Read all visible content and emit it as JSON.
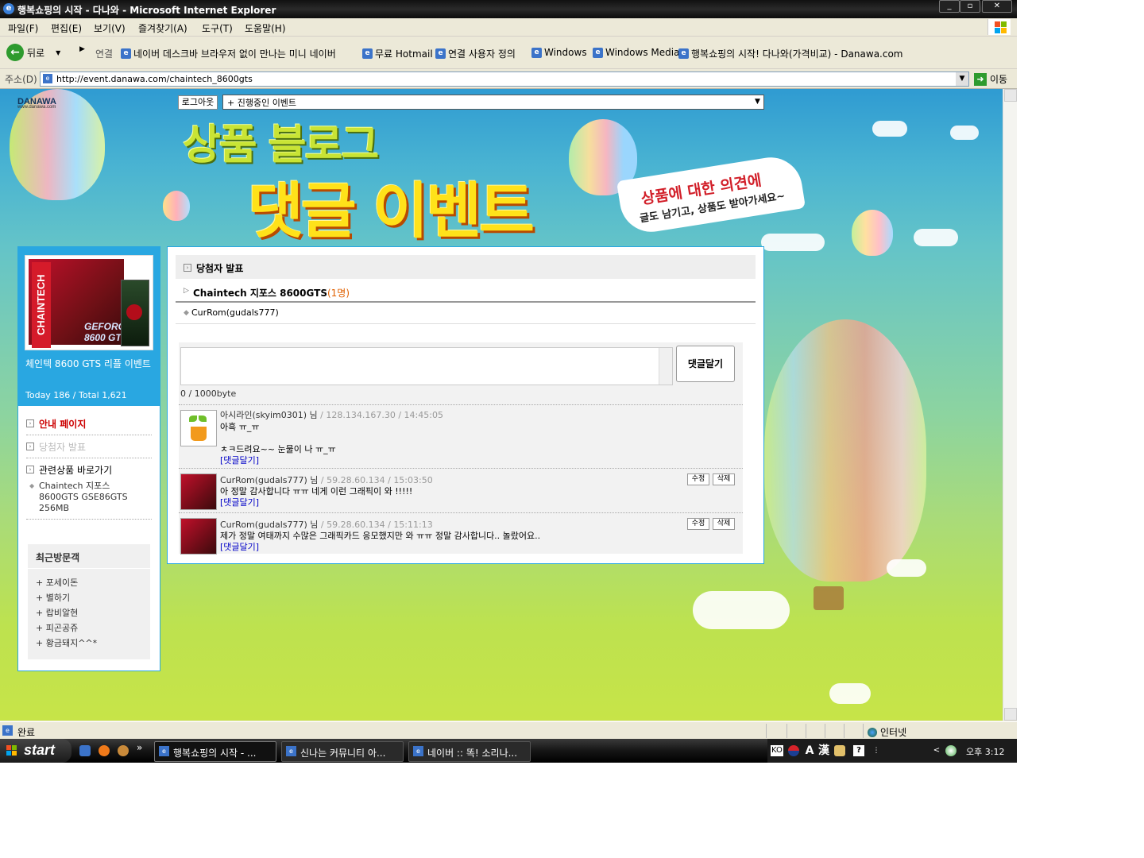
{
  "window": {
    "title": "행복쇼핑의 시작 - 다나와 - Microsoft Internet Explorer",
    "min": "_",
    "max": "▫",
    "close": "✕"
  },
  "menu": [
    "파일(F)",
    "편집(E)",
    "보기(V)",
    "즐겨찾기(A)",
    "도구(T)",
    "도움말(H)"
  ],
  "toolbar": {
    "back_label": "뒤로",
    "links_label": "연결",
    "links": [
      "네이버 데스크바 브라우저 없이 만나는 미니 네이버",
      "무료 Hotmail",
      "연결 사용자 정의",
      "Windows",
      "Windows Media",
      "행복쇼핑의 시작! 다나와(가격비교) - Danawa.com"
    ]
  },
  "address": {
    "label": "주소(D)",
    "url": "http://event.danawa.com/chaintech_8600gts",
    "go_label": "이동"
  },
  "banner": {
    "logo": "DANAWA",
    "logo_sub": "www.danawa.com",
    "logout": "로그아웃",
    "event_select": "+ 진행중인 이벤트",
    "title_line1": "상품 블로그",
    "title_line2": "댓글 이벤트",
    "ribbon_line1": "상품에 대한 의견에",
    "ribbon_line2": "글도 남기고, 상품도 받아가세요~"
  },
  "sidebar": {
    "box_brand": "CHAINTECH",
    "box_model": "GEFORCE 8600 GTS",
    "product_name": "체인텍 8600 GTS 리플 이벤트",
    "stats": "Today 186 / Total 1,621",
    "menu": {
      "guide": "안내 페이지",
      "winners": "당첨자 발표",
      "related": "관련상품 바로가기",
      "related_item": "Chaintech 지포스 8600GTS GSE86GTS 256MB"
    },
    "recent": {
      "title": "최근방문객",
      "visitors": [
        "+ 포세이돈",
        "+ 별하기",
        "+ 랍비알현",
        "+ 피곤공쥬",
        "+ 황금돼지^^*"
      ]
    }
  },
  "main": {
    "header": "당첨자 발표",
    "product": "Chaintech 지포스 8600GTS",
    "product_count": "(1명)",
    "winner": "CurRom(gudals777)",
    "submit": "댓글달기",
    "bytes": "0 / 1000byte",
    "comments": [
      {
        "author": "아시라인(skyim0301) 님",
        "ip_time": " / 128.134.167.30 / 14:45:05",
        "line1": "아흑 ㅠ_ㅠ",
        "line2": "ㅊㅋ드려요~~ 눈물이 나 ㅠ_ㅠ",
        "reply": "[댓글달기]"
      },
      {
        "author": "CurRom(gudals777) 님",
        "ip_time": " / 59.28.60.134 / 15:03:50",
        "line1": "아 정말 감사합니다 ㅠㅠ 네게 이런 그래픽이 와 !!!!!",
        "reply": "[댓글달기]",
        "edit": "수정",
        "delete": "삭제"
      },
      {
        "author": "CurRom(gudals777) 님",
        "ip_time": " / 59.28.60.134 / 15:11:13",
        "line1": "제가 정말 여태까지 수많은 그래픽카드 응모했지만 와 ㅠㅠ 정말 감사합니다.. 놀랐어요..",
        "reply": "[댓글달기]",
        "edit": "수정",
        "delete": "삭제"
      }
    ]
  },
  "status": {
    "text": "완료",
    "zone": "인터넷"
  },
  "taskbar": {
    "start": "start",
    "more": "»",
    "tasks": [
      "행복쇼핑의 시작 - ...",
      "신나는 커뮤니티 아...",
      "네이버 :: 똑! 소리나..."
    ],
    "tray_lang": "KO",
    "tray_a": "A",
    "tray_han": "漢",
    "tray_help": "?",
    "tray_chevron": "<",
    "clock": "오후 3:12"
  },
  "colors": {
    "accent": "#29a7e1",
    "red_label": "#cc0000",
    "link_blue": "#0000c8"
  }
}
